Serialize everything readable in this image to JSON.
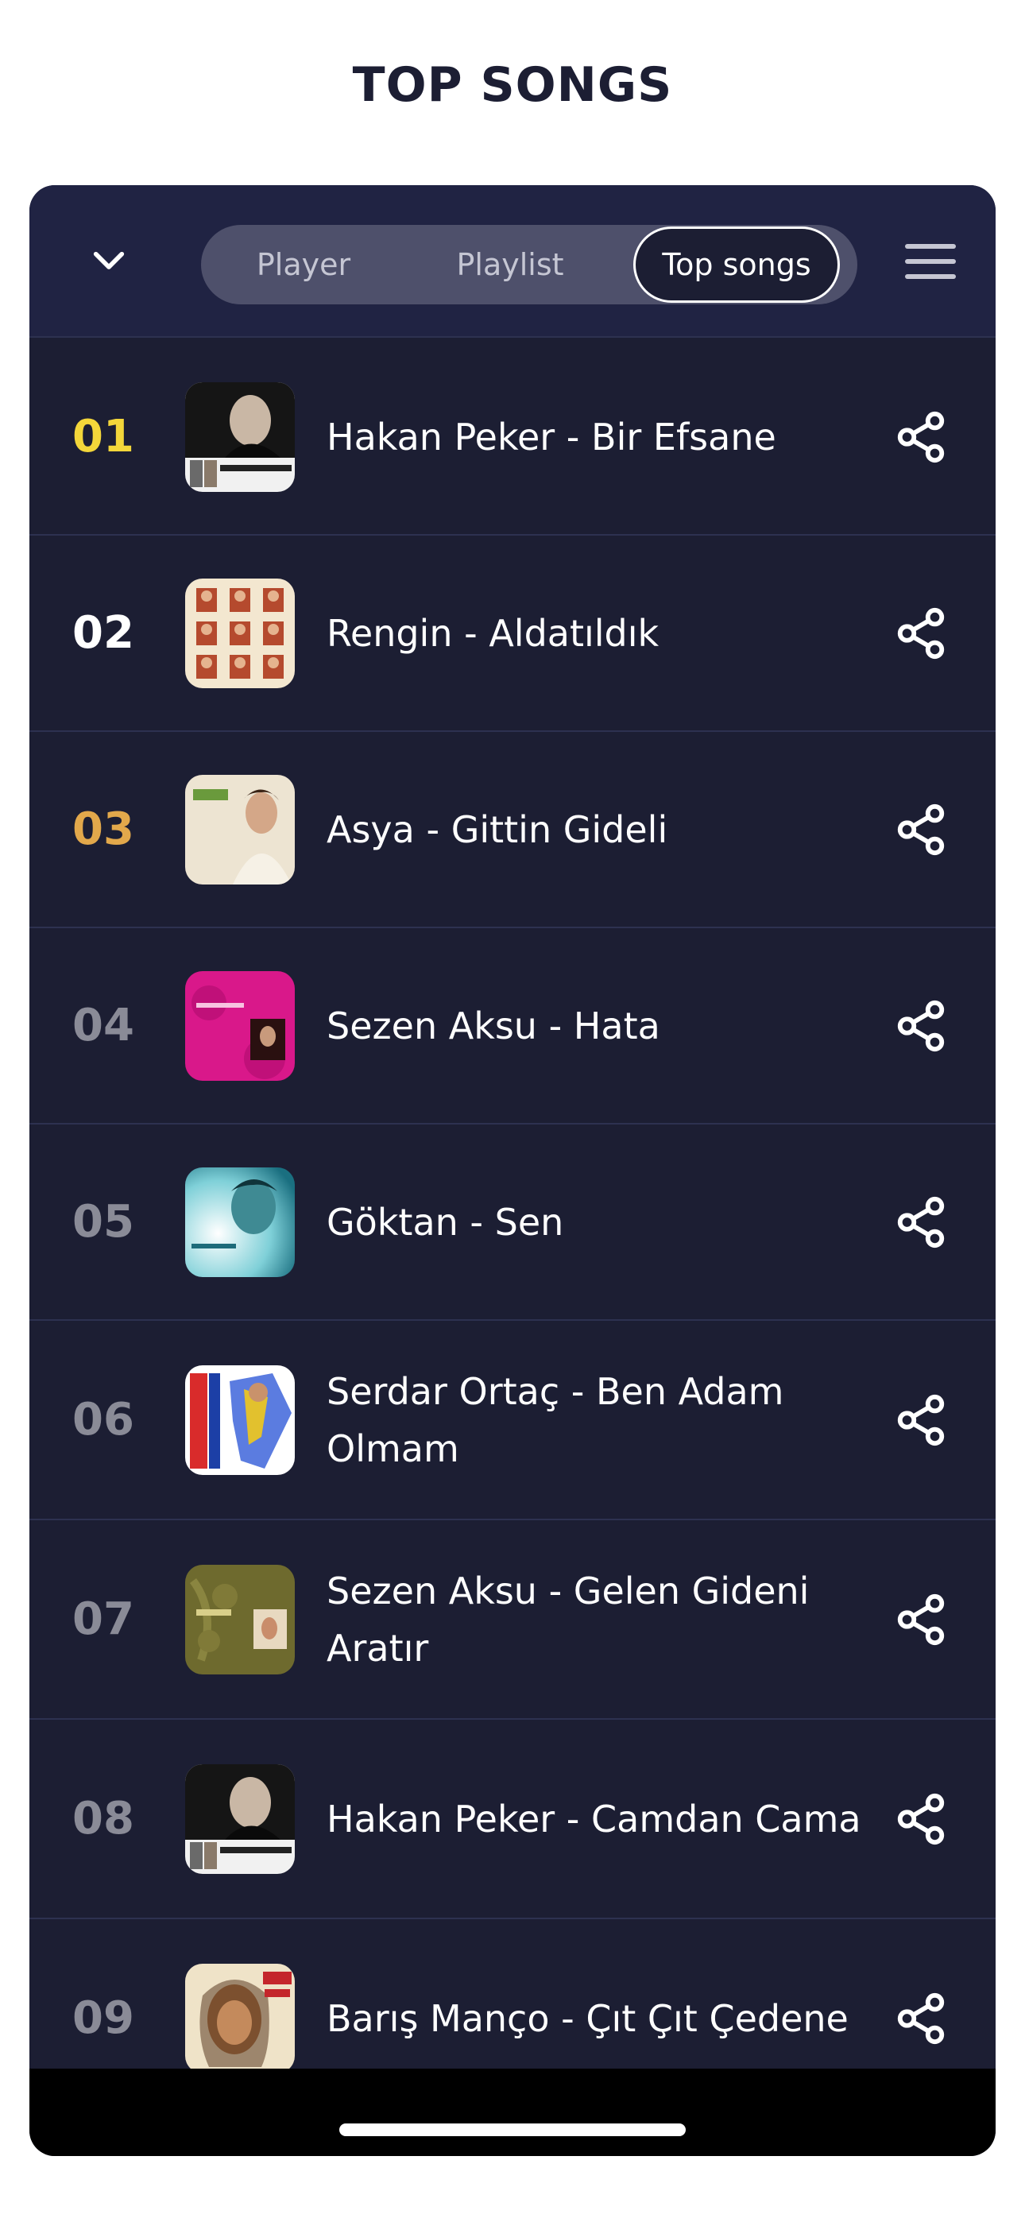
{
  "page": {
    "title": "TOP SONGS"
  },
  "tabs": [
    {
      "label": "Player",
      "active": false
    },
    {
      "label": "Playlist",
      "active": false
    },
    {
      "label": "Top songs",
      "active": true
    }
  ],
  "songs": [
    {
      "rank": "01",
      "title": "Hakan Peker - Bir Efsane"
    },
    {
      "rank": "02",
      "title": "Rengin - Aldatıldık"
    },
    {
      "rank": "03",
      "title": "Asya - Gittin Gideli"
    },
    {
      "rank": "04",
      "title": "Sezen Aksu - Hata"
    },
    {
      "rank": "05",
      "title": "Göktan - Sen"
    },
    {
      "rank": "06",
      "title": "Serdar Ortaç - Ben Adam Olmam"
    },
    {
      "rank": "07",
      "title": "Sezen Aksu - Gelen Gideni Aratır"
    },
    {
      "rank": "08",
      "title": "Hakan Peker - Camdan Cama"
    },
    {
      "rank": "09",
      "title": "Barış Manço - Çıt Çıt Çedene"
    }
  ],
  "icons": {
    "collapse": "chevron-down-icon",
    "menu": "hamburger-menu-icon",
    "share": "share-icon"
  },
  "colors": {
    "card_bg": "#1c1e33",
    "rank_1": "#f3d63a",
    "rank_2": "#ffffff",
    "rank_3": "#e2a84b",
    "rank_other": "#8a8b97"
  }
}
